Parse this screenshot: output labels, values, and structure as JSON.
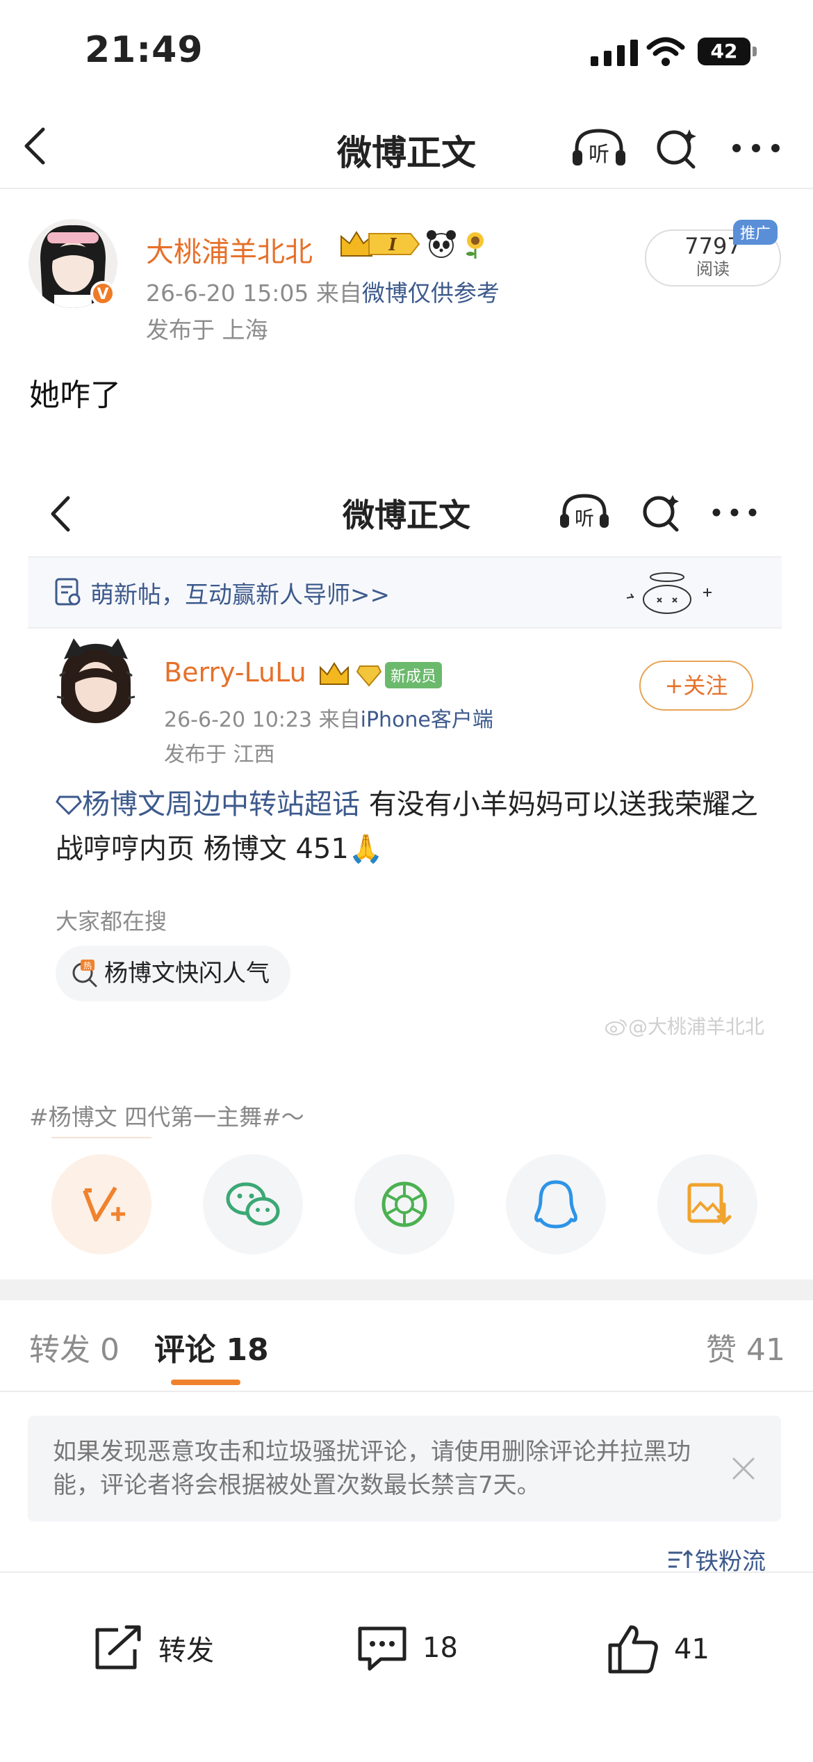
{
  "status": {
    "time": "21:49",
    "battery": "42"
  },
  "nav": {
    "title": "微博正文",
    "listen": "听"
  },
  "post": {
    "author": "大桃浦羊北北",
    "date_line": "26-6-20 15:05  来自",
    "source": "微博仅供参考",
    "location": "发布于 上海",
    "reads": "7797",
    "reads_label": "阅读",
    "promo": "推广",
    "text": "她咋了"
  },
  "screenshot": {
    "title": "微博正文",
    "listen": "听",
    "banner": "萌新帖，互动赢新人导师>>",
    "author": "Berry-LuLu",
    "badge_new": "新成员",
    "follow": "+关注",
    "date_line": "26-6-20 10:23  来自",
    "source": "iPhone客户端",
    "location": "发布于 江西",
    "topic": "杨博文周边中转站超话",
    "body": "  有没有小羊妈妈可以送我荣耀之战哼哼内页 杨博文 451🙏",
    "search_label": "大家都在搜",
    "search_chip": "杨博文快闪人气",
    "hot_badge": "热",
    "watermark": "@大桃浦羊北北"
  },
  "hashtag": "#杨博文 四代第一主舞#～",
  "share_targets": [
    "vplus-icon",
    "wechat-icon",
    "moments-icon",
    "qq-icon",
    "save-image-icon"
  ],
  "tabs": {
    "repost": "转发",
    "repost_count": "0",
    "comment": "评论",
    "comment_count": "18",
    "like": "赞",
    "like_count": "41"
  },
  "notice": "如果发现恶意攻击和垃圾骚扰评论，请使用删除评论并拉黑功能，评论者将会根据被处置次数最长禁言7天。",
  "sort_label": "铁粉流",
  "bottom": {
    "repost": "转发",
    "comments": "18",
    "likes": "41"
  },
  "colors": {
    "accent": "#e6702a",
    "link": "#3d5a8c",
    "orange_tab": "#f0822e"
  }
}
